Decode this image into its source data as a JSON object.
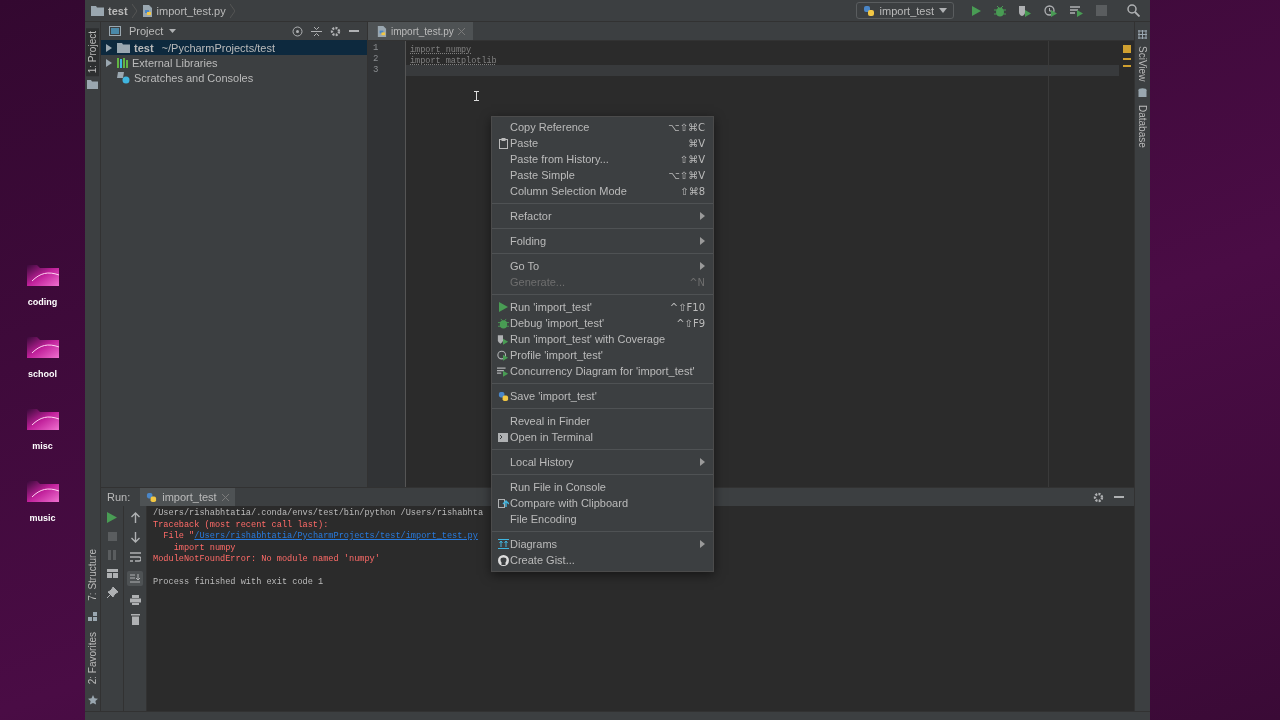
{
  "desktop": {
    "folders": [
      {
        "label": "coding"
      },
      {
        "label": "school"
      },
      {
        "label": "misc"
      },
      {
        "label": "music"
      }
    ]
  },
  "navbar": {
    "breadcrumbs": [
      "test",
      "import_test.py"
    ],
    "run_config": "import_test"
  },
  "left_strip": {
    "top_tabs": [
      {
        "label": "1: Project",
        "selected": true
      }
    ],
    "bottom_tabs": [
      {
        "label": "7: Structure",
        "selected": false
      },
      {
        "label": "2: Favorites",
        "selected": false
      }
    ]
  },
  "project_panel": {
    "title": "Project",
    "tree": [
      {
        "label": "test",
        "detail": "~/PycharmProjects/test",
        "kind": "folder",
        "has_children": true,
        "expanded": false,
        "selected": true
      },
      {
        "label": "External Libraries",
        "kind": "library",
        "has_children": true,
        "expanded": false,
        "selected": false
      },
      {
        "label": "Scratches and Consoles",
        "kind": "scratches",
        "has_children": false,
        "selected": false
      }
    ]
  },
  "editor": {
    "tabs": [
      {
        "label": "import_test.py",
        "selected": true
      }
    ],
    "lines": [
      {
        "number": "1",
        "code": "import numpy",
        "current": false
      },
      {
        "number": "2",
        "code": "import matplotlib",
        "current": false
      },
      {
        "number": "3",
        "current": true
      }
    ]
  },
  "right_strip": {
    "tabs": [
      "SciView",
      "Database"
    ]
  },
  "run_panel": {
    "label": "Run:",
    "tabs": [
      {
        "label": "import_test",
        "selected": true
      }
    ],
    "console": [
      {
        "kind": "plain",
        "text": "/Users/rishabhtatia/.conda/envs/test/bin/python /Users/rishabhta"
      },
      {
        "kind": "error",
        "text": "Traceback (most recent call last):"
      },
      {
        "kind": "error-link",
        "text": "  File \"",
        "link": "/Users/rishabhtatia/PycharmProjects/test/import_test.py"
      },
      {
        "kind": "error",
        "text": "    import numpy"
      },
      {
        "kind": "error",
        "text": "ModuleNotFoundError: No module named 'numpy'"
      },
      {
        "kind": "blank"
      },
      {
        "kind": "plain",
        "text": "Process finished with exit code 1"
      }
    ]
  },
  "context_menu": {
    "groups": [
      [
        {
          "label": "Copy Reference",
          "shortcut": "⌥⇧⌘C",
          "submenu": false,
          "disabled": false
        },
        {
          "label": "Paste",
          "shortcut": "⌘V",
          "submenu": false,
          "disabled": false
        },
        {
          "label": "Paste from History...",
          "shortcut": "⇧⌘V",
          "submenu": false,
          "disabled": false
        },
        {
          "label": "Paste Simple",
          "shortcut": "⌥⇧⌘V",
          "submenu": false,
          "disabled": false
        },
        {
          "label": "Column Selection Mode",
          "shortcut": "⇧⌘8",
          "submenu": false,
          "disabled": false
        }
      ],
      [
        {
          "label": "Refactor",
          "submenu": true,
          "disabled": false
        }
      ],
      [
        {
          "label": "Folding",
          "submenu": true,
          "disabled": false
        }
      ],
      [
        {
          "label": "Go To",
          "submenu": true,
          "disabled": false
        },
        {
          "label": "Generate...",
          "shortcut": "^N",
          "submenu": false,
          "disabled": true
        }
      ],
      [
        {
          "label": "Run 'import_test'",
          "shortcut": "^⇧F10",
          "submenu": false,
          "disabled": false
        },
        {
          "label": "Debug 'import_test'",
          "shortcut": "^⇧F9",
          "submenu": false,
          "disabled": false
        },
        {
          "label": "Run 'import_test' with Coverage",
          "submenu": false,
          "disabled": false
        },
        {
          "label": "Profile 'import_test'",
          "submenu": false,
          "disabled": false
        },
        {
          "label": "Concurrency Diagram for 'import_test'",
          "submenu": false,
          "disabled": false
        }
      ],
      [
        {
          "label": "Save 'import_test'",
          "submenu": false,
          "disabled": false
        }
      ],
      [
        {
          "label": "Reveal in Finder",
          "submenu": false,
          "disabled": false
        },
        {
          "label": "Open in Terminal",
          "submenu": false,
          "disabled": false
        }
      ],
      [
        {
          "label": "Local History",
          "submenu": true,
          "disabled": false
        }
      ],
      [
        {
          "label": "Run File in Console",
          "submenu": false,
          "disabled": false
        },
        {
          "label": "Compare with Clipboard",
          "submenu": false,
          "disabled": false
        },
        {
          "label": "File Encoding",
          "submenu": false,
          "disabled": false
        }
      ],
      [
        {
          "label": "Diagrams",
          "submenu": true,
          "disabled": false
        },
        {
          "label": "Create Gist...",
          "submenu": false,
          "disabled": false
        }
      ]
    ]
  }
}
